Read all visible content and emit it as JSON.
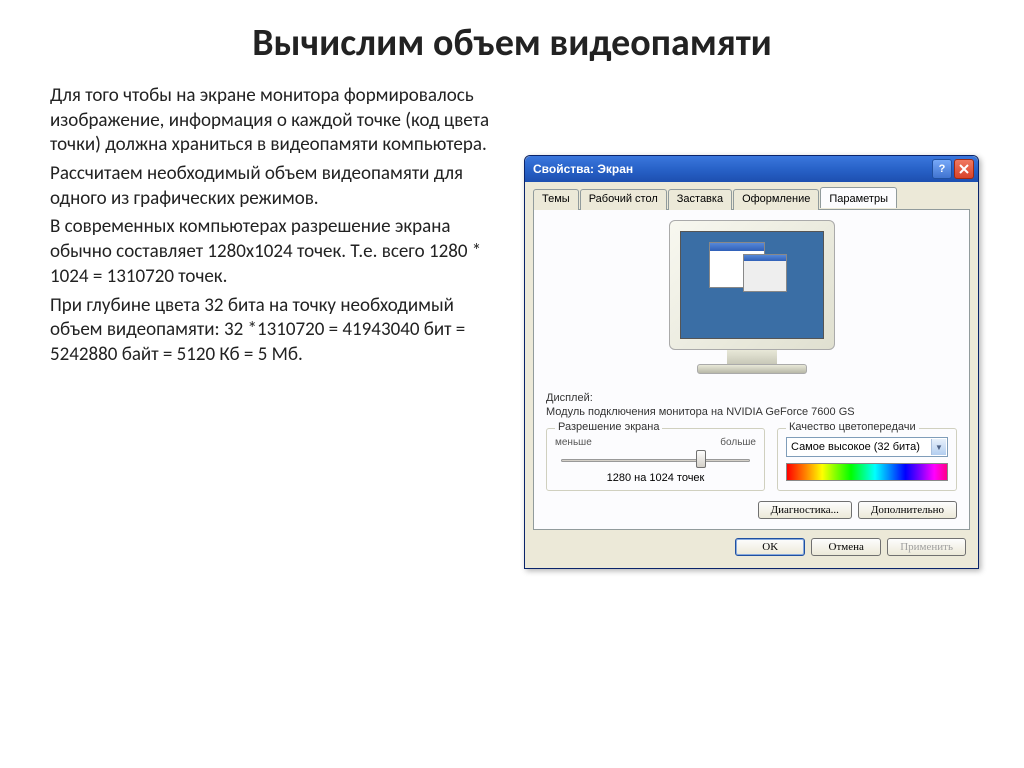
{
  "slide": {
    "title": "Вычислим объем видеопамяти",
    "p1": "Для того чтобы на экране монитора формировалось изображение, информация о каждой точке (код цвета точки) должна храниться в видеопамяти компьютера.",
    "p2": "Рассчитаем необходимый объем видеопамяти для одного из графических режимов.",
    "p3": "В современных компьютерах разрешение экрана обычно составляет 1280х1024 точек. Т.е. всего 1280 * 1024 = 1310720 точек.",
    "p4": "При глубине цвета 32 бита на точку необходимый объем видеопамяти: 32 *1310720 = 41943040 бит = 5242880 байт = 5120 Кб = 5 Мб."
  },
  "dialog": {
    "title": "Свойства: Экран",
    "tabs": [
      "Темы",
      "Рабочий стол",
      "Заставка",
      "Оформление",
      "Параметры"
    ],
    "display_label": "Дисплей:",
    "display_value": "Модуль подключения монитора на NVIDIA GeForce 7600 GS",
    "res_group": "Разрешение экрана",
    "res_less": "меньше",
    "res_more": "больше",
    "res_value": "1280 на 1024 точек",
    "quality_group": "Качество цветопередачи",
    "quality_value": "Самое высокое (32 бита)",
    "diag_btn": "Диагностика...",
    "adv_btn": "Дополнительно",
    "ok": "OK",
    "cancel": "Отмена",
    "apply": "Применить"
  }
}
